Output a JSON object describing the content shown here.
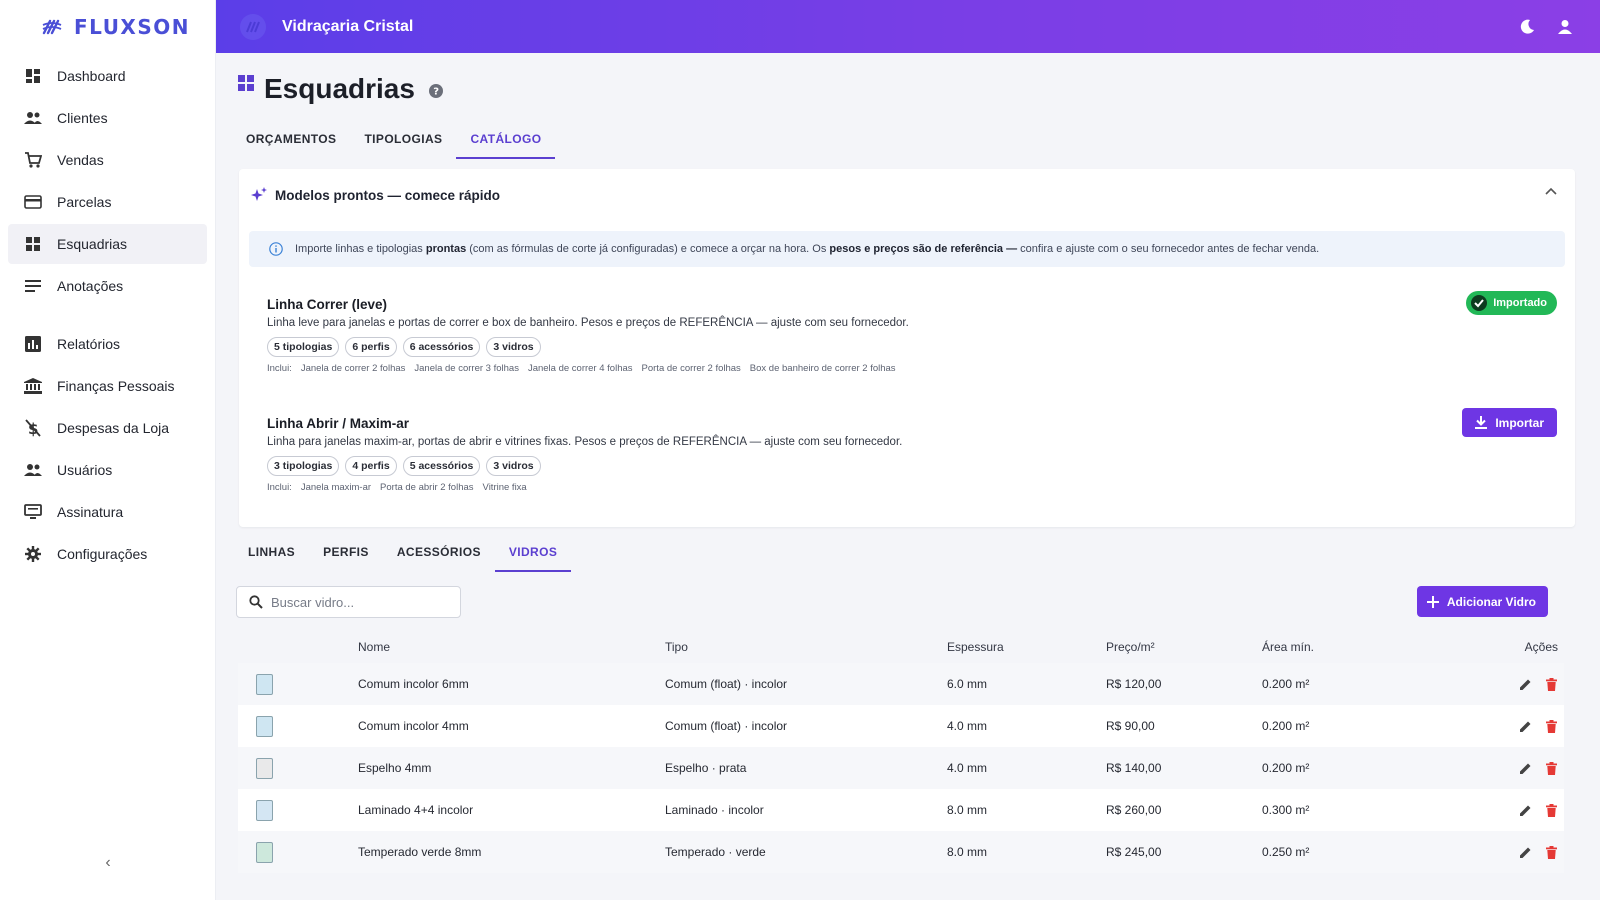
{
  "brand": {
    "name": "FLUXSON"
  },
  "header": {
    "title": "Vidraçaria Cristal"
  },
  "sidebar": {
    "items": [
      {
        "label": "Dashboard"
      },
      {
        "label": "Clientes"
      },
      {
        "label": "Vendas"
      },
      {
        "label": "Parcelas"
      },
      {
        "label": "Esquadrias"
      },
      {
        "label": "Anotações"
      },
      {
        "label": "Relatórios"
      },
      {
        "label": "Finanças Pessoais"
      },
      {
        "label": "Despesas da Loja"
      },
      {
        "label": "Usuários"
      },
      {
        "label": "Assinatura"
      },
      {
        "label": "Configurações"
      }
    ]
  },
  "page": {
    "title": "Esquadrias"
  },
  "main_tabs": [
    "ORÇAMENTOS",
    "TIPOLOGIAS",
    "CATÁLOGO"
  ],
  "catalog": {
    "section_title": "Modelos prontos — comece rápido",
    "info": {
      "p1": "Importe linhas e tipologias",
      "b1": "prontas",
      "p2": "(com as fórmulas de corte já configuradas) e comece a orçar na hora. Os",
      "b2": "pesos e preços são de referência —",
      "p3": "confira e ajuste com o seu fornecedor antes de fechar venda."
    },
    "models": [
      {
        "name": "Linha Correr (leve)",
        "desc": "Linha leve para janelas e portas de correr e box de banheiro. Pesos e preços de REFERÊNCIA — ajuste com seu fornecedor.",
        "chips": [
          "5 tipologias",
          "6 perfis",
          "6 acessórios",
          "3 vidros"
        ],
        "includes_label": "Inclui:",
        "includes": [
          "Janela de correr 2 folhas",
          "Janela de correr 3 folhas",
          "Janela de correr 4 folhas",
          "Porta de correr 2 folhas",
          "Box de banheiro de correr 2 folhas"
        ],
        "status": "Importado"
      },
      {
        "name": "Linha Abrir / Maxim-ar",
        "desc": "Linha para janelas maxim-ar, portas de abrir e vitrines fixas. Pesos e preços de REFERÊNCIA — ajuste com seu fornecedor.",
        "chips": [
          "3 tipologias",
          "4 perfis",
          "5 acessórios",
          "3 vidros"
        ],
        "includes_label": "Inclui:",
        "includes": [
          "Janela maxim-ar",
          "Porta de abrir 2 folhas",
          "Vitrine fixa"
        ],
        "action": "Importar"
      }
    ]
  },
  "sub_tabs": [
    "LINHAS",
    "PERFIS",
    "ACESSÓRIOS",
    "VIDROS"
  ],
  "search": {
    "placeholder": "Buscar vidro..."
  },
  "add_button": "Adicionar Vidro",
  "table": {
    "headers": [
      "Nome",
      "Tipo",
      "Espessura",
      "Preço/m²",
      "Área mín.",
      "Ações"
    ],
    "rows": [
      {
        "nome": "Comum incolor 6mm",
        "tipo": "Comum (float) · incolor",
        "espessura": "6.0 mm",
        "preco": "R$ 120,00",
        "area": "0.200 m²",
        "color": "#cfe6f2"
      },
      {
        "nome": "Comum incolor 4mm",
        "tipo": "Comum (float) · incolor",
        "espessura": "4.0 mm",
        "preco": "R$ 90,00",
        "area": "0.200 m²",
        "color": "#cfe6f2"
      },
      {
        "nome": "Espelho 4mm",
        "tipo": "Espelho · prata",
        "espessura": "4.0 mm",
        "preco": "R$ 140,00",
        "area": "0.200 m²",
        "color": "#e9e9ea"
      },
      {
        "nome": "Laminado 4+4 incolor",
        "tipo": "Laminado · incolor",
        "espessura": "8.0 mm",
        "preco": "R$ 260,00",
        "area": "0.300 m²",
        "color": "#d4e6f3"
      },
      {
        "nome": "Temperado verde 8mm",
        "tipo": "Temperado · verde",
        "espessura": "8.0 mm",
        "preco": "R$ 245,00",
        "area": "0.250 m²",
        "color": "#cde8dc"
      }
    ]
  },
  "colors": {
    "accent": "#6e36e4",
    "header_from": "#5b3ee8",
    "header_to": "#8b3fe6",
    "success": "#22b857",
    "danger": "#e53935"
  }
}
